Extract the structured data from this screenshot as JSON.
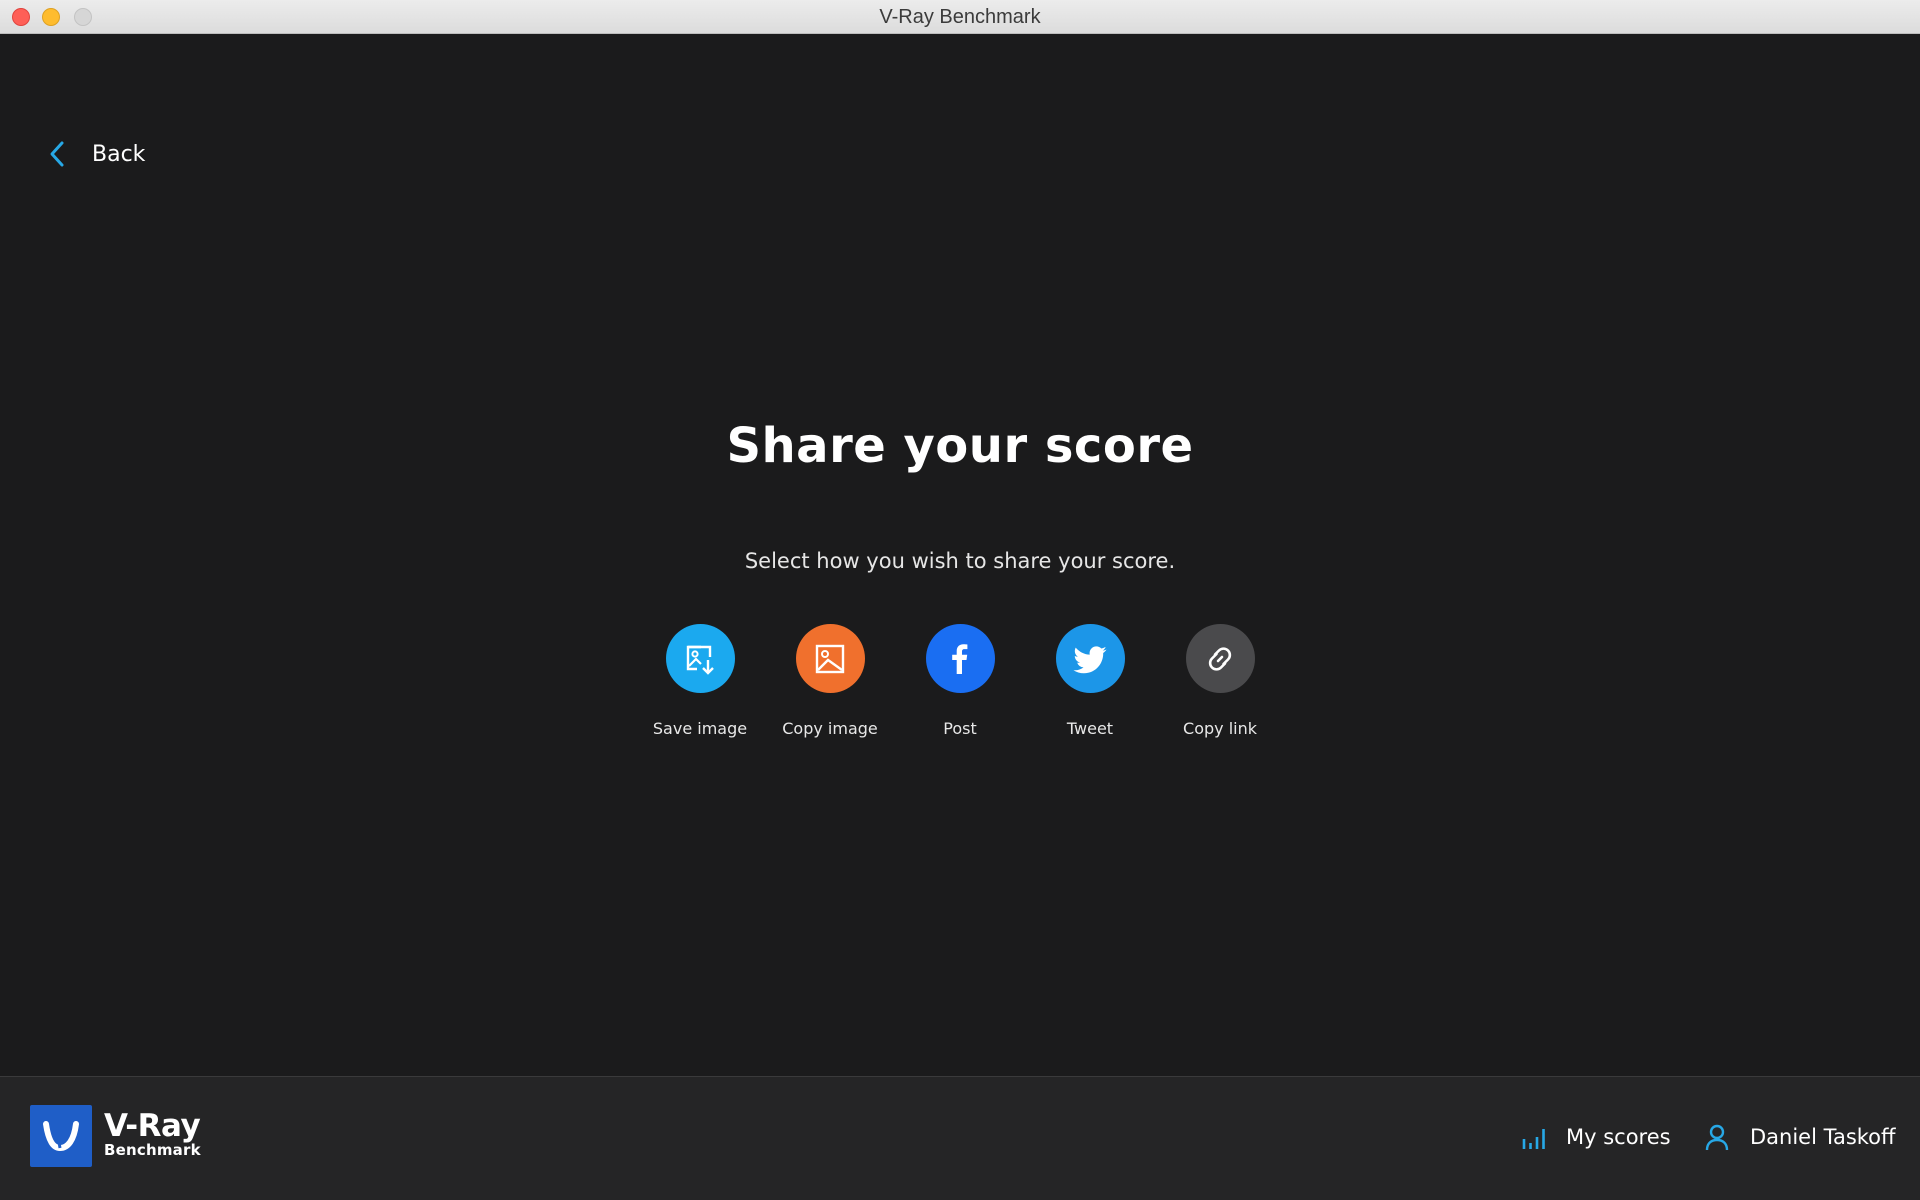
{
  "window": {
    "title": "V-Ray Benchmark"
  },
  "nav": {
    "back_label": "Back"
  },
  "main": {
    "title": "Share your score",
    "subtitle": "Select how you wish to share your score.",
    "share_options": [
      {
        "label": "Save image",
        "icon": "image-download-icon",
        "color": "#1ba9ef"
      },
      {
        "label": "Copy image",
        "icon": "image-icon",
        "color": "#f0702d"
      },
      {
        "label": "Post",
        "icon": "facebook-icon",
        "color": "#1a6ef2"
      },
      {
        "label": "Tweet",
        "icon": "twitter-icon",
        "color": "#1c96e8"
      },
      {
        "label": "Copy link",
        "icon": "link-icon",
        "color": "#4a4a4c"
      }
    ]
  },
  "footer": {
    "logo_title": "V-Ray",
    "logo_subtitle": "Benchmark",
    "my_scores_label": "My scores",
    "user_name": "Daniel Taskoff",
    "accent_color": "#27a8e6"
  }
}
